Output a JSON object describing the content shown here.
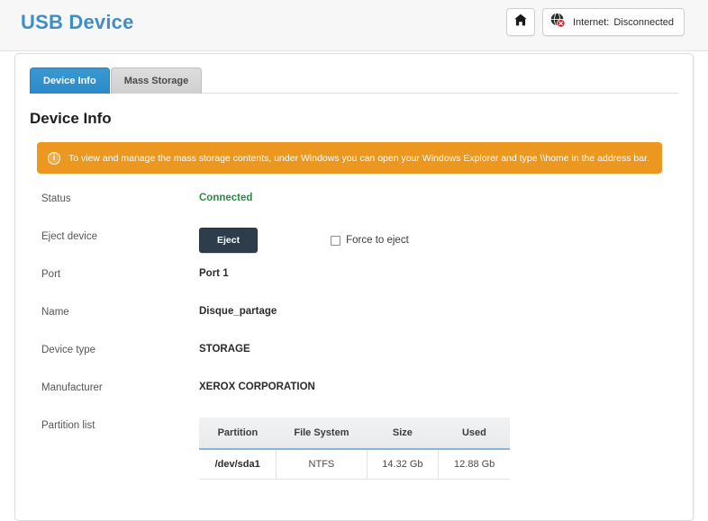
{
  "header": {
    "title": "USB Device",
    "home_icon": "home-icon",
    "network": {
      "icon": "globe-disconnected-icon",
      "label": "Internet:",
      "value": "Disconnected"
    }
  },
  "tabs": [
    {
      "label": "Device Info",
      "active": true
    },
    {
      "label": "Mass Storage",
      "active": false
    }
  ],
  "main": {
    "section_title": "Device Info",
    "alert": {
      "icon": "info-icon",
      "text": "To view and manage the mass storage contents, under Windows you can open your Windows Explorer and type \\\\home in the address bar."
    },
    "rows": {
      "status": {
        "label": "Status",
        "value": "Connected"
      },
      "eject": {
        "label": "Eject device",
        "button_label": "Eject",
        "checkbox_label": "Force to eject",
        "checkbox_checked": false
      },
      "port": {
        "label": "Port",
        "value": "Port 1"
      },
      "name": {
        "label": "Name",
        "value": "Disque_partage"
      },
      "device_type": {
        "label": "Device type",
        "value": "STORAGE"
      },
      "manufacturer": {
        "label": "Manufacturer",
        "value": "XEROX CORPORATION"
      },
      "partition_list": {
        "label": "Partition list"
      }
    },
    "partition_table": {
      "columns": [
        "Partition",
        "File System",
        "Size",
        "Used"
      ],
      "rows": [
        [
          "/dev/sda1",
          "NTFS",
          "14.32 Gb",
          "12.88 Gb"
        ]
      ]
    }
  },
  "colors": {
    "brand_blue": "#3f8fc4",
    "tab_active": "#2f8fce",
    "alert_orange": "#ec971f",
    "status_green": "#2e8b45",
    "button_dark": "#2e3d4c"
  }
}
